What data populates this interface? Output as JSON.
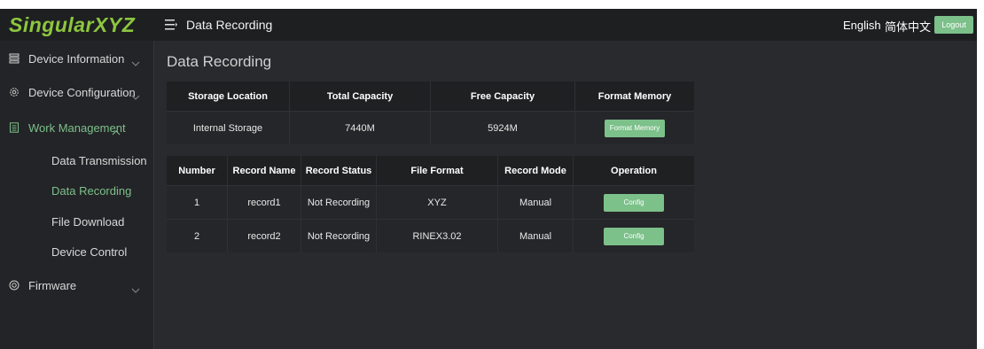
{
  "brand": {
    "logo_text": "SingularXYZ",
    "accent": "#7cc08a"
  },
  "header": {
    "menu_icon": "menu-fold-icon",
    "title": "Data Recording",
    "lang_en": "English",
    "lang_zh": "简体中文",
    "logout_label": "Logout"
  },
  "sidebar": {
    "items": [
      {
        "label": "Device Information",
        "icon": "list-icon",
        "expanded": false
      },
      {
        "label": "Device Configuration",
        "icon": "gear-icon",
        "expanded": false
      },
      {
        "label": "Work Management",
        "icon": "document-icon",
        "expanded": true,
        "children": [
          "Data Transmission",
          "Data Recording",
          "File Download",
          "Device Control"
        ]
      },
      {
        "label": "Firmware",
        "icon": "firmware-icon",
        "expanded": false
      }
    ],
    "active_child": "Data Recording"
  },
  "main": {
    "page_title": "Data Recording",
    "storage_table": {
      "headers": [
        "Storage Location",
        "Total Capacity",
        "Free Capacity",
        "Format Memory"
      ],
      "rows": [
        {
          "location": "Internal Storage",
          "total": "7440M",
          "free": "5924M",
          "action_label": "Format Memory"
        }
      ]
    },
    "record_table": {
      "headers": [
        "Number",
        "Record Name",
        "Record Status",
        "File Format",
        "Record Mode",
        "Operation"
      ],
      "rows": [
        {
          "number": "1",
          "name": "record1",
          "status": "Not Recording",
          "format": "XYZ",
          "mode": "Manual",
          "action_label": "Config"
        },
        {
          "number": "2",
          "name": "record2",
          "status": "Not Recording",
          "format": "RINEX3.02",
          "mode": "Manual",
          "action_label": "Config"
        }
      ]
    }
  }
}
